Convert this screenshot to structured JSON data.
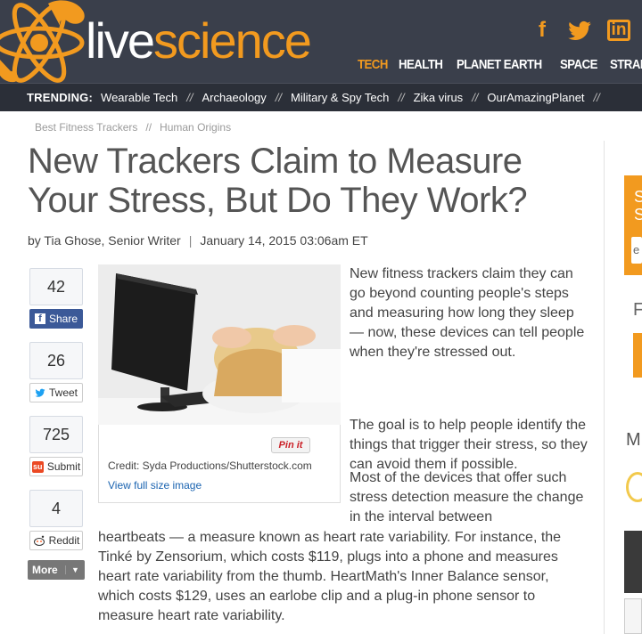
{
  "site": {
    "logo_live": "live",
    "logo_science": "science",
    "brand_color": "#f29a1f",
    "header_bg": "#3a3f4b"
  },
  "social_icons": [
    {
      "name": "facebook-icon",
      "glyph": "f"
    },
    {
      "name": "twitter-icon",
      "glyph": "t"
    },
    {
      "name": "linkedin-icon",
      "glyph": "in"
    }
  ],
  "nav": {
    "items": [
      "TECH",
      "HEALTH",
      "PLANET EARTH",
      "SPACE",
      "STRANGE NEWS"
    ],
    "active": "TECH"
  },
  "trending": {
    "label": "TRENDING:",
    "items": [
      "Wearable Tech",
      "Archaeology",
      "Military & Spy Tech",
      "Zika virus",
      "OurAmazingPlanet"
    ],
    "separator": "//"
  },
  "breadcrumb": {
    "items": [
      "Best Fitness Trackers",
      "Human Origins"
    ],
    "separator": "//"
  },
  "article": {
    "title": "New Trackers Claim to Measure Your Stress, But Do They Work?",
    "author": "by Tia Ghose, Senior Writer",
    "byline_sep": "|",
    "date": "January 14, 2015 03:06am ET",
    "paragraphs": [
      "New fitness trackers claim they can go beyond counting people's steps and measuring how long they sleep — now, these devices can tell people when they're stressed out.",
      "The goal is to help people identify the things that trigger their stress, so they can avoid them if possible.",
      "Most of the devices that offer such stress detection measure the change in the interval between",
      "heartbeats — a measure known as heart rate variability. For instance, the Tinké by Zensorium, which costs $119, plugs into a phone and measures heart rate variability from the thumb. HeartMath's Inner Balance sensor, which costs $129, uses an earlobe clip and a plug-in phone sensor to measure heart rate variability."
    ]
  },
  "figure": {
    "pin_label": "Pin it",
    "credit": "Credit: Syda Productions/Shutterstock.com",
    "full_size_link": "View full size image"
  },
  "share": {
    "facebook": {
      "count": "42",
      "label": "Share"
    },
    "twitter": {
      "count": "26",
      "label": "Tweet"
    },
    "stumbleupon": {
      "count": "725",
      "label": "Submit"
    },
    "reddit": {
      "count": "4",
      "label": "Reddit"
    },
    "more_label": "More"
  },
  "sidebar": {
    "promo_letters": "S\nS",
    "input_value": "e",
    "heading_f": "F",
    "heading_m": "M"
  }
}
